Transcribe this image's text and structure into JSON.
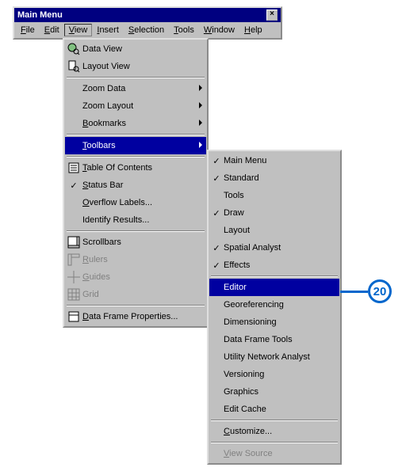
{
  "window": {
    "title": "Main Menu"
  },
  "menubar": {
    "items": [
      {
        "label": "File",
        "u": 0
      },
      {
        "label": "Edit",
        "u": 0
      },
      {
        "label": "View",
        "u": 0
      },
      {
        "label": "Insert",
        "u": 0
      },
      {
        "label": "Selection",
        "u": 0
      },
      {
        "label": "Tools",
        "u": 0
      },
      {
        "label": "Window",
        "u": 0
      },
      {
        "label": "Help",
        "u": 0
      }
    ],
    "selected": "View"
  },
  "viewMenu": {
    "items": [
      {
        "label": "Data View",
        "icon": "globe-magnifier-icon",
        "u": -1
      },
      {
        "label": "Layout View",
        "icon": "page-magnifier-icon",
        "u": -1
      },
      {
        "sep": true
      },
      {
        "label": "Zoom Data",
        "submenu": true,
        "u": -1
      },
      {
        "label": "Zoom Layout",
        "submenu": true,
        "u": -1
      },
      {
        "label": "Bookmarks",
        "submenu": true,
        "u": 0
      },
      {
        "sep": true
      },
      {
        "label": "Toolbars",
        "submenu": true,
        "highlight": true,
        "u": 0
      },
      {
        "sep": true
      },
      {
        "label": "Table Of Contents",
        "icon": "toc-icon",
        "u": 0
      },
      {
        "label": "Status Bar",
        "checked": true,
        "u": 0
      },
      {
        "label": "Overflow Labels...",
        "u": 0
      },
      {
        "label": "Identify Results...",
        "u": -1
      },
      {
        "sep": true
      },
      {
        "label": "Scrollbars",
        "icon": "scrollbars-icon",
        "u": -1
      },
      {
        "label": "Rulers",
        "icon": "rulers-icon",
        "disabled": true,
        "u": 0
      },
      {
        "label": "Guides",
        "icon": "guides-icon",
        "disabled": true,
        "u": 0
      },
      {
        "label": "Grid",
        "icon": "grid-icon",
        "disabled": true,
        "u": -1
      },
      {
        "sep": true
      },
      {
        "label": "Data Frame Properties...",
        "icon": "properties-icon",
        "u": 0
      }
    ]
  },
  "toolbarsMenu": {
    "items": [
      {
        "label": "Main Menu",
        "checked": true
      },
      {
        "label": "Standard",
        "checked": true
      },
      {
        "label": "Tools"
      },
      {
        "label": "Draw",
        "checked": true
      },
      {
        "label": "Layout"
      },
      {
        "label": "Spatial Analyst",
        "checked": true
      },
      {
        "label": "Effects",
        "checked": true
      },
      {
        "sep": true
      },
      {
        "label": "Editor",
        "highlight": true
      },
      {
        "label": "Georeferencing"
      },
      {
        "label": "Dimensioning"
      },
      {
        "label": "Data Frame Tools"
      },
      {
        "label": "Utility Network Analyst"
      },
      {
        "label": "Versioning"
      },
      {
        "label": "Graphics"
      },
      {
        "label": "Edit Cache"
      },
      {
        "sep": true
      },
      {
        "label": "Customize...",
        "u": 0
      },
      {
        "sep": true
      },
      {
        "label": "View Source",
        "disabled": true,
        "u": 0
      }
    ]
  },
  "callout": {
    "number": "20"
  }
}
